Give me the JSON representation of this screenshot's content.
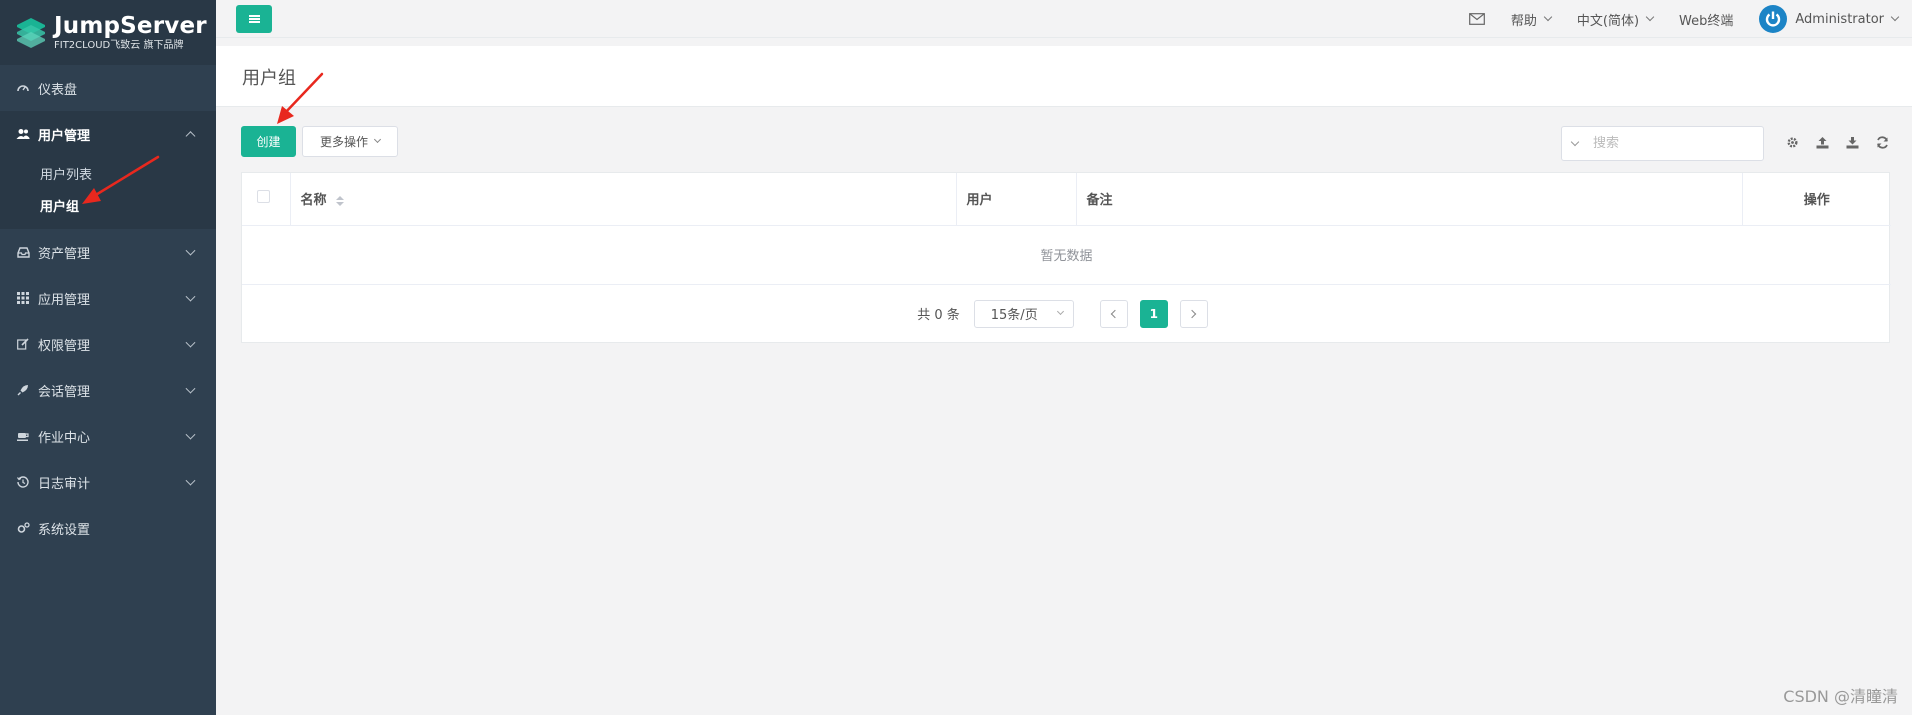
{
  "brand": {
    "title": "JumpServer",
    "subtitle": "FIT2CLOUD飞致云 旗下品牌",
    "accent": "#1ab394",
    "sidebar_bg": "#2f4050"
  },
  "sidebar": {
    "items": [
      {
        "label": "仪表盘",
        "icon": "dashboard-icon"
      },
      {
        "label": "用户管理",
        "icon": "users-icon",
        "children": [
          {
            "label": "用户列表"
          },
          {
            "label": "用户组"
          }
        ]
      },
      {
        "label": "资产管理",
        "icon": "inbox-icon"
      },
      {
        "label": "应用管理",
        "icon": "grid-icon"
      },
      {
        "label": "权限管理",
        "icon": "edit-icon"
      },
      {
        "label": "会话管理",
        "icon": "rocket-icon"
      },
      {
        "label": "作业中心",
        "icon": "coffee-icon"
      },
      {
        "label": "日志审计",
        "icon": "history-icon"
      },
      {
        "label": "系统设置",
        "icon": "gears-icon"
      }
    ]
  },
  "topbar": {
    "help": "帮助",
    "language": "中文(简体)",
    "web_terminal": "Web终端",
    "user": "Administrator"
  },
  "page": {
    "title": "用户组"
  },
  "toolbar": {
    "create": "创建",
    "more_actions": "更多操作",
    "search_placeholder": "搜索"
  },
  "table": {
    "columns": [
      "名称",
      "用户",
      "备注",
      "操作"
    ],
    "empty_text": "暂无数据"
  },
  "pagination": {
    "total": "共 0 条",
    "page_size": "15条/页",
    "current_page": "1"
  },
  "watermark": "CSDN @清瞳清"
}
